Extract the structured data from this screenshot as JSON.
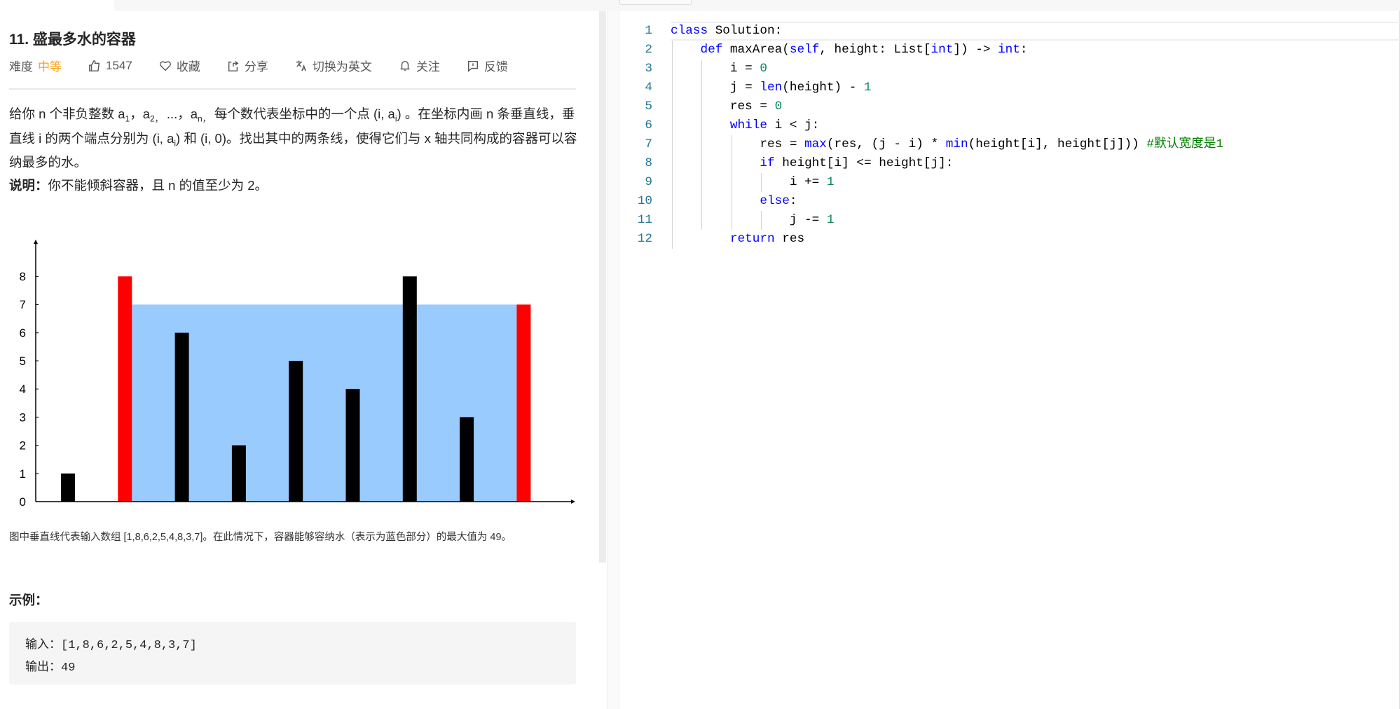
{
  "problem": {
    "title": "11. 盛最多水的容器",
    "meta": {
      "difficulty_label": "难度",
      "difficulty": "中等",
      "likes": "1547",
      "favorite": "收藏",
      "share": "分享",
      "switch_lang": "切换为英文",
      "follow": "关注",
      "feedback": "反馈"
    },
    "desc": {
      "p1": "给你 n 个非负整数 a",
      "s1": "1",
      "p2": "，a",
      "s2": "2，",
      "p3": "...，a",
      "s3": "n，",
      "p4": "每个数代表坐标中的一个点 (i, a",
      "s4": "i",
      "p5": ") 。在坐标内画 n 条垂直线，垂直线 i 的两个端点分别为 (i, a",
      "s5": "i",
      "p6": ") 和 (i, 0)。找出其中的两条线，使得它们与 x 轴共同构成的容器可以容纳最多的水。"
    },
    "note_label": "说明：",
    "note_text": "你不能倾斜容器，且 n 的值至少为 2。",
    "caption": "图中垂直线代表输入数组 [1,8,6,2,5,4,8,3,7]。在此情况下，容器能够容纳水（表示为蓝色部分）的最大值为 49。",
    "example_heading": "示例：",
    "example_input": "输入：[1,8,6,2,5,4,8,3,7]",
    "example_output": "输出：49"
  },
  "chart_data": {
    "type": "bar",
    "values": [
      1,
      8,
      6,
      2,
      5,
      4,
      8,
      3,
      7
    ],
    "highlight_indices": [
      1,
      8
    ],
    "water_level": 7,
    "yticks": [
      "0",
      "1",
      "2",
      "3",
      "4",
      "5",
      "6",
      "7",
      "8"
    ],
    "ylim": [
      0,
      9
    ],
    "colors": {
      "bar": "#000000",
      "highlight": "#ff0000",
      "water": "#99cbff"
    }
  },
  "editor": {
    "lines": [
      [
        [
          "class",
          "kw"
        ],
        [
          " Solution:",
          ""
        ]
      ],
      [
        [
          "    ",
          ""
        ],
        [
          "def",
          "kw"
        ],
        [
          " maxArea(",
          ""
        ],
        [
          "self",
          "kw"
        ],
        [
          ", height: List[",
          ""
        ],
        [
          "int",
          "kw"
        ],
        [
          "]) -> ",
          ""
        ],
        [
          "int",
          "kw"
        ],
        [
          ":",
          ""
        ]
      ],
      [
        [
          "        i = ",
          ""
        ],
        [
          "0",
          "num"
        ]
      ],
      [
        [
          "        j = ",
          ""
        ],
        [
          "len",
          "kw"
        ],
        [
          "(height) - ",
          ""
        ],
        [
          "1",
          "num"
        ]
      ],
      [
        [
          "        res = ",
          ""
        ],
        [
          "0",
          "num"
        ]
      ],
      [
        [
          "        ",
          ""
        ],
        [
          "while",
          "kw"
        ],
        [
          " i < j:",
          ""
        ]
      ],
      [
        [
          "            res = ",
          ""
        ],
        [
          "max",
          "kw"
        ],
        [
          "(res, (j - i) * ",
          ""
        ],
        [
          "min",
          "kw"
        ],
        [
          "(height[i], height[j])) ",
          ""
        ],
        [
          "#默认宽度是1",
          "cm"
        ]
      ],
      [
        [
          "            ",
          ""
        ],
        [
          "if",
          "kw"
        ],
        [
          " height[i] <= height[j]:",
          ""
        ]
      ],
      [
        [
          "                i += ",
          ""
        ],
        [
          "1",
          "num"
        ]
      ],
      [
        [
          "            ",
          ""
        ],
        [
          "else",
          "kw"
        ],
        [
          ":",
          ""
        ]
      ],
      [
        [
          "                j -= ",
          ""
        ],
        [
          "1",
          "num"
        ]
      ],
      [
        [
          "        ",
          ""
        ],
        [
          "return",
          "kw"
        ],
        [
          " res",
          ""
        ]
      ]
    ]
  }
}
